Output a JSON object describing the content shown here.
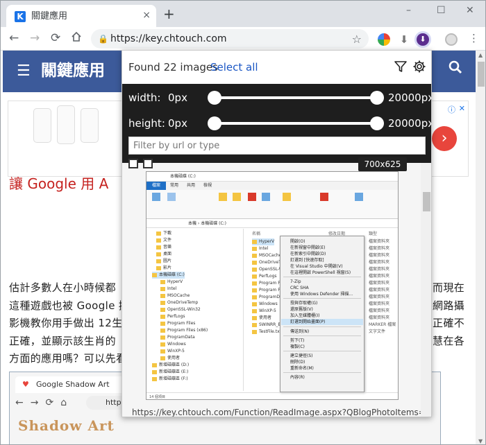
{
  "browser": {
    "tab_title": "關鍵應用",
    "favicon_letter": "K",
    "url": "https://key.chtouch.com",
    "tab_close": "×",
    "new_tab": "+",
    "window_min": "–",
    "window_max": "☐",
    "window_close": "✕"
  },
  "site": {
    "title": "關鍵應用",
    "article_title": "讓 Google 用 A",
    "paragraph_lines": [
      "估計多數人在小時候都",
      "這種遊戲也被 Google 搬",
      "影機教你用手做出 12生",
      "正確，並顯示該生肖的",
      "方面的應用嗎？可以先看"
    ],
    "paragraph_lines_right": [
      "而現在",
      "網路攝",
      "正確不",
      "慧在各",
      ""
    ],
    "embedded_tab": "Google Shadow Art",
    "embedded_url": "https://",
    "embedded_heading": "Shadow Art"
  },
  "popup": {
    "found_text": "Found 22 images",
    "select_all": "Select all",
    "width_label": "width:",
    "height_label": "height:",
    "width_min": "0px",
    "width_max": "20000px",
    "height_min": "0px",
    "height_max": "20000px",
    "filter_placeholder": "Filter by url or type",
    "image_size": "700x625",
    "image_url": "https://key.chtouch.com/Function/ReadImage.aspx?QBlogPhotoItems=1517",
    "slider_range": {
      "width_min_value": 0,
      "width_max_value": 20000,
      "height_min_value": 0,
      "height_max_value": 20000
    }
  },
  "explorer": {
    "title": "本機磁碟 (C:)",
    "tabs": [
      "檔案",
      "常用",
      "共用",
      "檢視"
    ],
    "address": "本機 › 本機磁碟 (C:)",
    "tree": [
      "下載",
      "文件",
      "音樂",
      "桌面",
      "圖片",
      "影片",
      "本機磁碟 (C:)",
      "HyperV",
      "Intel",
      "MSOCache",
      "OneDriveTemp",
      "OpenSSL-Win32",
      "PerfLogs",
      "Program Files",
      "Program Files (x86)",
      "ProgramData",
      "Windows",
      "WinXP-5",
      "使用者",
      "新增磁碟區 (D:)",
      "新增磁碟區 (E:)",
      "新增磁碟區 (F:)"
    ],
    "columns": [
      "名稱",
      "修改日期",
      "類型"
    ],
    "files": [
      "HyperV",
      "Intel",
      "MSOCache",
      "OneDriveTem",
      "OpenSSL-Wi",
      "PerfLogs",
      "Program File",
      "Program File",
      "ProgramDat",
      "Windows",
      "WinXP-5",
      "使用者",
      "SWINRR_BA",
      "TestFile.txt"
    ],
    "types": [
      "檔案資料夾",
      "檔案資料夾",
      "檔案資料夾",
      "檔案資料夾",
      "檔案資料夾",
      "檔案資料夾",
      "檔案資料夾",
      "檔案資料夾",
      "檔案資料夾",
      "檔案資料夾",
      "檔案資料夾",
      "檔案資料夾",
      "MARKER 檔案",
      "文字文件"
    ],
    "context_menu": [
      "開啟(O)",
      "在新視窗中開啟(E)",
      "在新索引中開啟(D)",
      "釘選到 [快速存取]",
      "在 Visual Studio 中開啟(V)",
      "在這裡開啟 PowerShell 視窗(S)",
      "7-Zip",
      "CRC SHA",
      "使用 Windows Defender 掃描...",
      "授與存取權(G)",
      "還原舊版(V)",
      "加入至媒體櫃(I)",
      "釘選到開始畫面(P)",
      "傳送到(N)",
      "剪下(T)",
      "複製(C)",
      "建立捷徑(S)",
      "刪除(D)",
      "重新命名(M)",
      "內容(R)"
    ],
    "status": "14 個項目"
  },
  "colors": {
    "site_header": "#3c5a9a",
    "article_title": "#c5221f",
    "popup_controls_bg": "#1e1e1e",
    "select_all_link": "#1a56c4",
    "ad_arrow": "#e8453c"
  }
}
